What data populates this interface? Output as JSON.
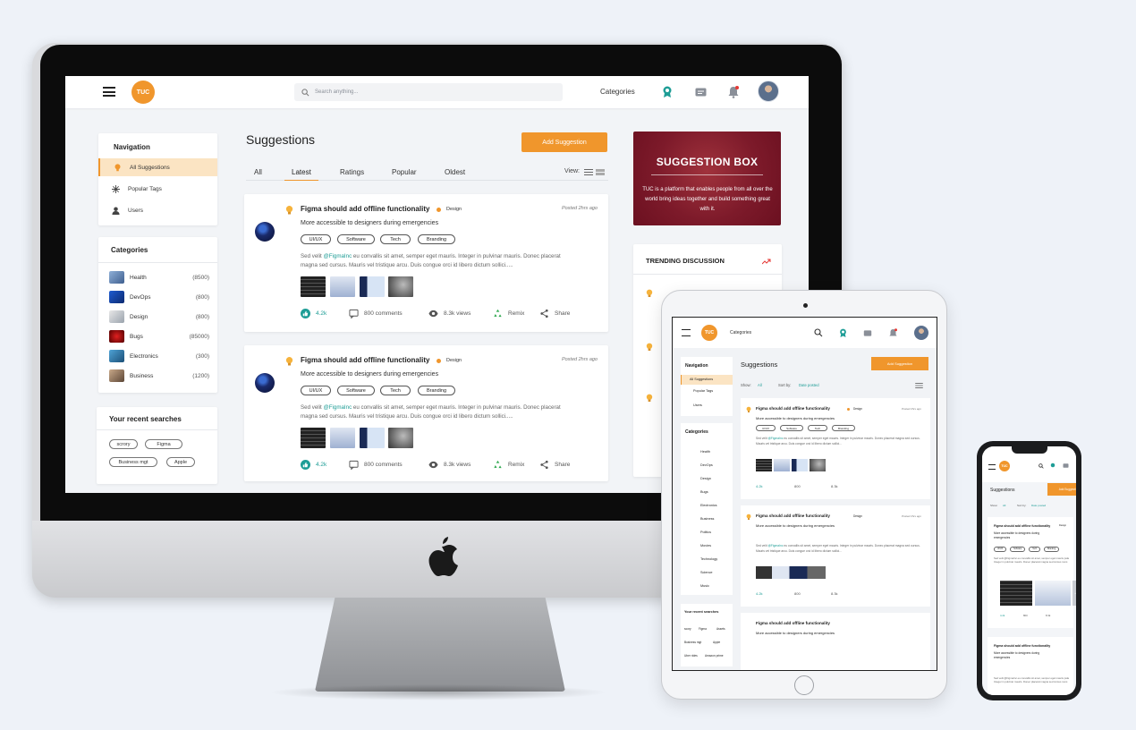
{
  "desktop": {
    "logo": "TUC",
    "search_placeholder": "Search anything...",
    "categories_link": "Categories",
    "nav": {
      "title": "Navigation",
      "items": [
        "All Suggestions",
        "Popular Tags",
        "Users"
      ]
    },
    "categories": {
      "title": "Categories",
      "items": [
        {
          "name": "Health",
          "count": "(8500)"
        },
        {
          "name": "DevOps",
          "count": "(800)"
        },
        {
          "name": "Design",
          "count": "(800)"
        },
        {
          "name": "Bugs",
          "count": "(85000)"
        },
        {
          "name": "Electronics",
          "count": "(300)"
        },
        {
          "name": "Business",
          "count": "(1200)"
        }
      ]
    },
    "recent_searches": {
      "title": "Your recent searches",
      "chips": [
        "scrory",
        "Figma",
        "Business mgt",
        "Apple"
      ]
    },
    "page_title": "Suggestions",
    "add_button": "Add Suggestion",
    "tabs": [
      "All",
      "Latest",
      "Ratings",
      "Popular",
      "Oldest"
    ],
    "view_label": "View:",
    "posts": [
      {
        "title": "Figma should add offline functionality",
        "tag": "Design",
        "posted": "Posted 2hrs ago",
        "subtitle": "More accessible to designers during emergencies",
        "tags": [
          "UI/UX",
          "Software",
          "Tech",
          "Branding"
        ],
        "body_pre": "Sed velit ",
        "mention": "@FigmaInc",
        "body_post": " eu convallis sit amet, semper eget mauris. Integer in pulvinar mauris. Donec placerat magna sed cursus. Mauris vel tristique arcu. Duis congue orci id libero dictum sollici.....",
        "likes": "4.2k",
        "comments": "800 comments",
        "views": "8.3k views",
        "remix": "Remix",
        "share": "Share"
      },
      {
        "title": "Figma should add offline functionality",
        "tag": "Design",
        "posted": "Posted 2hrs ago",
        "subtitle": "More accessible to designers during emergencies",
        "tags": [
          "UI/UX",
          "Software",
          "Tech",
          "Branding"
        ],
        "body_pre": "Sed velit ",
        "mention": "@FigmaInc",
        "body_post": " eu convallis sit amet, semper eget mauris. Integer in pulvinar mauris. Donec placerat magna sed cursus. Mauris vel tristique arcu. Duis congue orci id libero dictum sollici.....",
        "likes": "4.2k",
        "comments": "800 comments",
        "views": "8.3k views",
        "remix": "Remix",
        "share": "Share"
      }
    ],
    "suggestion_box": {
      "title": "SUGGESTION BOX",
      "text": "TUC is a platform that enables people from all over the world bring ideas together and build something great with it."
    },
    "trending": {
      "title": "TRENDING DISCUSSION"
    }
  },
  "tablet": {
    "logo": "TUC",
    "categories_link": "Categories",
    "nav_title": "Navigation",
    "nav_items": [
      "All Suggestions",
      "Popular Tags",
      "Users"
    ],
    "categories_title": "Categories",
    "categories": [
      "Health",
      "DevOps",
      "Design",
      "Bugs",
      "Electronics",
      "Business",
      "Politics",
      "Movies",
      "Technology",
      "Science",
      "Music"
    ],
    "recent_title": "Your recent searches",
    "recent_chips": [
      "scory",
      "Figma",
      "Assets",
      "Business mgt",
      "Apple",
      "Uber rides",
      "Amazon prime"
    ],
    "page_title": "Suggestions",
    "add_button": "Add Suggestion",
    "show_label": "Show:",
    "show_value": "All",
    "sort_label": "Sort by:",
    "sort_value": "Date posted",
    "post_title": "Figma should add offline functionality",
    "post_tag": "Design",
    "posted": "Posted 2hrs ago",
    "post_subtitle": "More accessible to designers during emergencies",
    "post_tags": [
      "UI/UX",
      "Software",
      "Tech",
      "Branding"
    ],
    "body_pre": "Sed velit ",
    "mention": "@FigmaInc",
    "body_post": " eu convallis sit amet, semper eget mauris. Integer in pulvinar mauris. Donec placerat magna sed cursus. Mauris vel tristique arcu. Duis congue orci id libero dictum sollici...",
    "likes": "4.2k",
    "comments": "800",
    "views": "8.3k"
  },
  "phone": {
    "logo": "TUC",
    "page_title": "Suggestions",
    "add_button": "Add Suggestion",
    "show_label": "Show:",
    "show_value": "All",
    "sort_label": "Sort by:",
    "sort_value": "Date posted",
    "post_title": "Figma should add offline functionality",
    "post_tag": "Design",
    "post_subtitle": "More accessible to designers during emergencies",
    "post_tags": [
      "UI/UX",
      "Software",
      "Tech",
      "Branding"
    ],
    "body": "Sed velit @FigmaInc eu convallis sit amet, semper eget mauris jsda Integer in pulvinar mauris. Donec placerat magna sed cursus nunc.",
    "more_images": "+2",
    "likes": "4.2k",
    "comments": "800",
    "views": "8.3k"
  },
  "colors": {
    "accent": "#f0962c",
    "teal": "#1e9d96",
    "maroon": "#7d1a2a"
  }
}
